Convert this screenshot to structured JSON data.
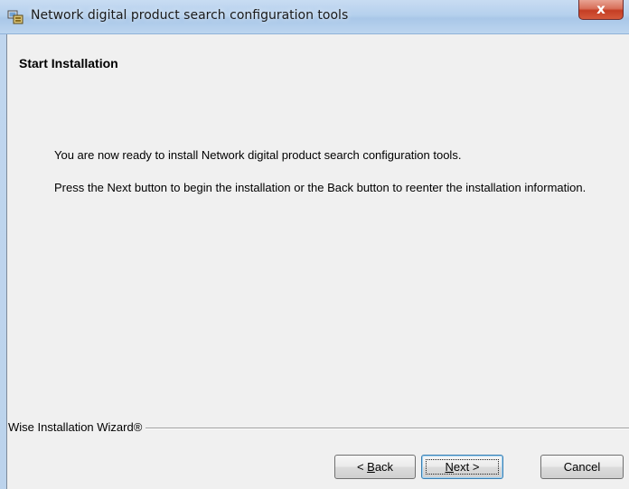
{
  "window": {
    "title": "Network digital product search configuration tools",
    "app_icon": "installer-app-icon",
    "close_glyph": "x"
  },
  "page": {
    "heading": "Start Installation",
    "paragraph1": "You are now ready to install Network digital product search configuration tools.",
    "paragraph2": "Press the Next button to begin the installation or the Back button to reenter the installation information."
  },
  "footer": {
    "brand": "Wise Installation Wizard®"
  },
  "buttons": {
    "back": {
      "prefix": "< ",
      "accel": "B",
      "rest": "ack"
    },
    "next": {
      "accel": "N",
      "rest": "ext >"
    },
    "cancel": "Cancel"
  },
  "colors": {
    "dialog_bg": "#f0f0f0",
    "titlebar": "#b5d0ed",
    "close_button": "#c43d24"
  }
}
